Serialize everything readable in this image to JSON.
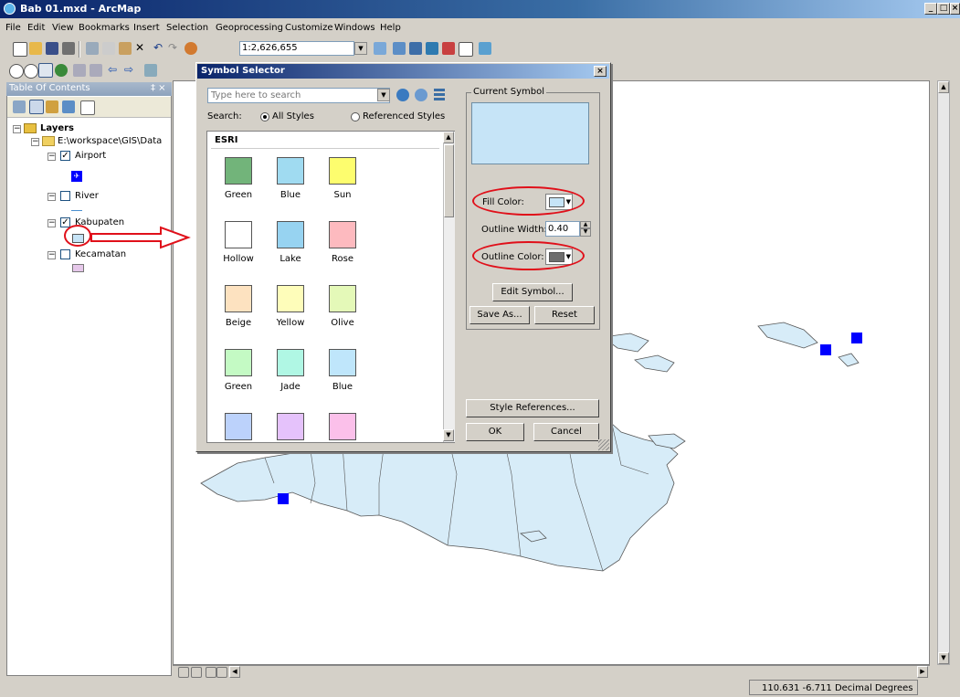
{
  "window": {
    "title": "Bab 01.mxd - ArcMap",
    "controls": [
      "_",
      "□",
      "×"
    ]
  },
  "menu": [
    "File",
    "Edit",
    "View",
    "Bookmarks",
    "Insert",
    "Selection",
    "Geoprocessing",
    "Customize",
    "Windows",
    "Help"
  ],
  "toolbar": {
    "scale": "1:2,626,655"
  },
  "toc": {
    "title": "Table Of Contents",
    "pin": "‡ ×",
    "root": "Layers",
    "folder": "E:\\workspace\\GIS\\Data",
    "layers": [
      {
        "name": "Airport",
        "checked": true
      },
      {
        "name": "River",
        "checked": false
      },
      {
        "name": "Kabupaten",
        "checked": true
      },
      {
        "name": "Kecamatan",
        "checked": false
      }
    ]
  },
  "dialog": {
    "title": "Symbol Selector",
    "search_placeholder": "Type here to search",
    "search_label": "Search:",
    "all_styles": "All Styles",
    "referenced_styles": "Referenced Styles",
    "gallery_header": "ESRI",
    "symbols": [
      {
        "name": "Green",
        "color": "#72b47a"
      },
      {
        "name": "Blue",
        "color": "#a0dbf1"
      },
      {
        "name": "Sun",
        "color": "#fdfd6e"
      },
      {
        "name": "Hollow",
        "color": "#ffffff"
      },
      {
        "name": "Lake",
        "color": "#97d3f1"
      },
      {
        "name": "Rose",
        "color": "#fdbabf"
      },
      {
        "name": "Beige",
        "color": "#fde2c0"
      },
      {
        "name": "Yellow",
        "color": "#fefdba"
      },
      {
        "name": "Olive",
        "color": "#e4f9b8"
      },
      {
        "name": "Green",
        "color": "#c4fac4"
      },
      {
        "name": "Jade",
        "color": "#b0f7e4"
      },
      {
        "name": "Blue",
        "color": "#bfe6fb"
      },
      {
        "name": "",
        "color": "#bcd2fb"
      },
      {
        "name": "",
        "color": "#e5c2fb"
      },
      {
        "name": "",
        "color": "#fbc0ea"
      }
    ],
    "current_symbol_label": "Current Symbol",
    "current_fill": "#c6e4f7",
    "fill_color_label": "Fill Color:",
    "fill_color": "#c6e4f7",
    "outline_width_label": "Outline Width:",
    "outline_width": "0.40",
    "outline_color_label": "Outline Color:",
    "outline_color": "#6e6e6e",
    "edit_symbol": "Edit Symbol...",
    "save_as": "Save As...",
    "reset": "Reset",
    "style_references": "Style References...",
    "ok": "OK",
    "cancel": "Cancel"
  },
  "status": {
    "coords": "110.631  -6.711 Decimal Degrees"
  },
  "colors": {
    "annotation": "#e0101a",
    "map_fill": "#d7ecf8",
    "airport_marker": "#0000ff"
  }
}
